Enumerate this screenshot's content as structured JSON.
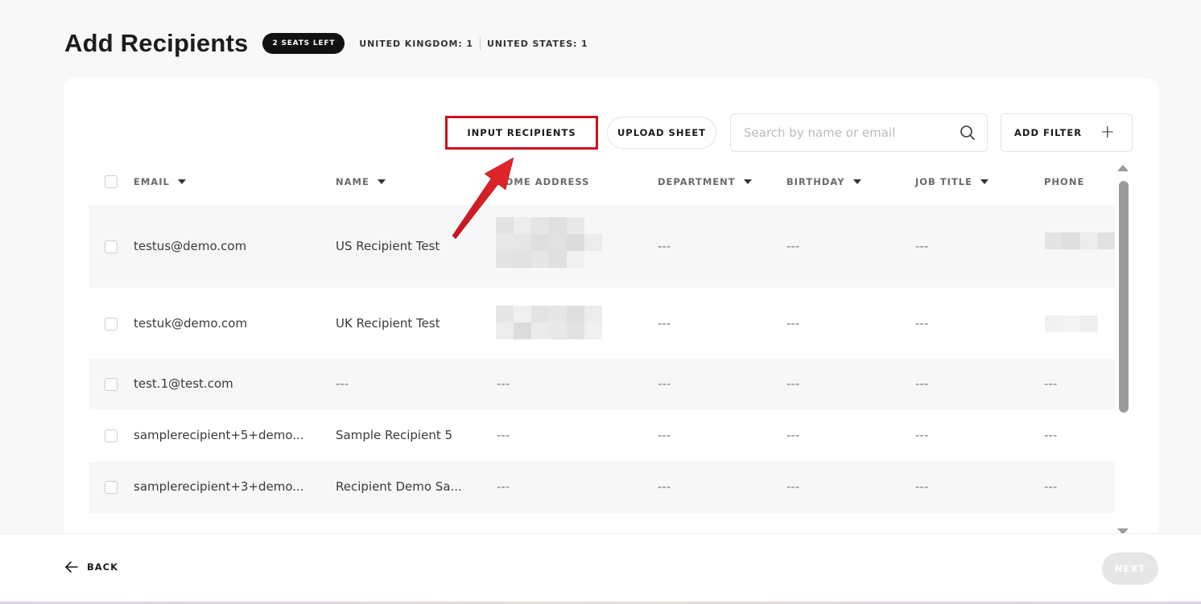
{
  "header": {
    "title": "Add Recipients",
    "seats_badge": "2 SEATS LEFT",
    "country_uk": "UNITED KINGDOM: 1",
    "country_us": "UNITED STATES: 1"
  },
  "toolbar": {
    "input_recipients": "INPUT RECIPIENTS",
    "upload_sheet": "UPLOAD SHEET",
    "search_placeholder": "Search by name or email",
    "add_filter": "ADD FILTER"
  },
  "table": {
    "columns": {
      "email": "EMAIL",
      "name": "NAME",
      "address": "HOME ADDRESS",
      "department": "DEPARTMENT",
      "birthday": "BIRTHDAY",
      "job_title": "JOB TITLE",
      "phone": "PHONE"
    },
    "rows": [
      {
        "email": "testus@demo.com",
        "name": "US Recipient Test",
        "department": "---",
        "birthday": "---",
        "job_title": "---"
      },
      {
        "email": "testuk@demo.com",
        "name": "UK Recipient Test",
        "department": "---",
        "birthday": "---",
        "job_title": "---"
      },
      {
        "email": "test.1@test.com",
        "name": "---",
        "address": "---",
        "department": "---",
        "birthday": "---",
        "job_title": "---",
        "phone": "---"
      },
      {
        "email": "samplerecipient+5+demo...",
        "name": "Sample Recipient 5",
        "address": "---",
        "department": "---",
        "birthday": "---",
        "job_title": "---",
        "phone": "---"
      },
      {
        "email": "samplerecipient+3+demo...",
        "name": "Recipient Demo Sa...",
        "address": "---",
        "department": "---",
        "birthday": "---",
        "job_title": "---",
        "phone": "---"
      }
    ]
  },
  "footer": {
    "back": "BACK",
    "next": "NEXT"
  },
  "colors": {
    "highlight": "#d0101a",
    "badge_bg": "#111111"
  }
}
